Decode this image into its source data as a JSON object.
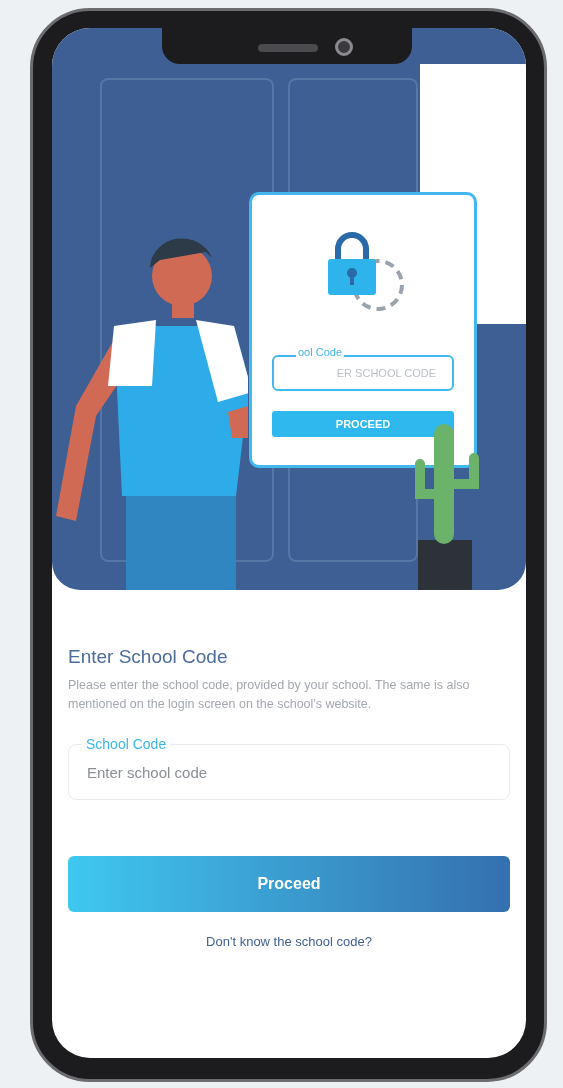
{
  "illustration": {
    "card": {
      "field_label": "ool Code",
      "field_placeholder": "ER SCHOOL CODE",
      "button": "PROCEED"
    }
  },
  "title": "Enter School Code",
  "description": "Please enter the school code, provided by your school. The same is also mentioned on the login screen on the school's website.",
  "school_code_field": {
    "label": "School Code",
    "placeholder": "Enter school code"
  },
  "proceed_button": "Proceed",
  "help_link": "Don't know the school code?"
}
